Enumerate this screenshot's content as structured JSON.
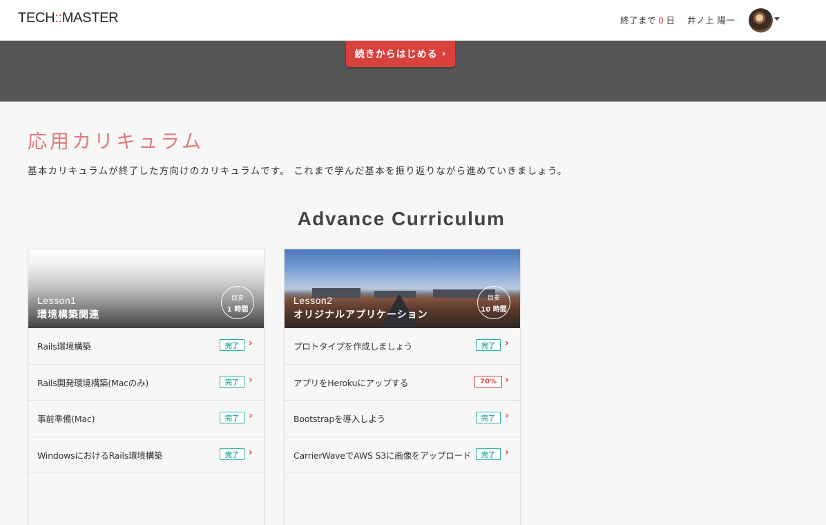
{
  "header": {
    "logo_prefix": "TECH",
    "logo_sep": "::",
    "logo_suffix": "MASTER",
    "countdown_before": "終了まで",
    "countdown_value": "0",
    "countdown_after": "日",
    "user_name": "井ノ上 陽一"
  },
  "banner": {
    "continue_label": "続きからはじめる",
    "continue_chevron": "›"
  },
  "section": {
    "title": "応用カリキュラム",
    "description": "基本カリキュラムが終了した方向けのカリキュラムです。 これまで学んだ基本を振り返りながら進めていきましょう。",
    "subtitle": "Advance Curriculum"
  },
  "colors": {
    "accent": "#d9413d",
    "done": "#2aaea3",
    "banner_bg": "#555555",
    "title": "#e07b78"
  },
  "lessons": [
    {
      "number": "Lesson1",
      "name": "環境構築関連",
      "estimate_label": "目安",
      "estimate_value": "1 時間",
      "items": [
        {
          "title": "Rails環境構築",
          "status": "完了"
        },
        {
          "title": "Rails開発環境構築(Macのみ)",
          "status": "完了"
        },
        {
          "title": "事前準備(Mac)",
          "status": "完了"
        },
        {
          "title": "WindowsにおけるRails環境構築",
          "status": "完了"
        }
      ]
    },
    {
      "number": "Lesson2",
      "name": "オリジナルアプリケーション",
      "estimate_label": "目安",
      "estimate_value": "10 時間",
      "items": [
        {
          "title": "プロトタイプを作成しましょう",
          "status": "完了"
        },
        {
          "title": "アプリをHerokuにアップする",
          "status": "70%",
          "progress": 0.7
        },
        {
          "title": "Bootstrapを導入しよう",
          "status": "完了"
        },
        {
          "title": "CarrierWaveでAWS S3に画像をアップロード",
          "status": "完了"
        }
      ]
    }
  ],
  "icons": {
    "chevron": "›",
    "caret": "caret-down-icon"
  }
}
